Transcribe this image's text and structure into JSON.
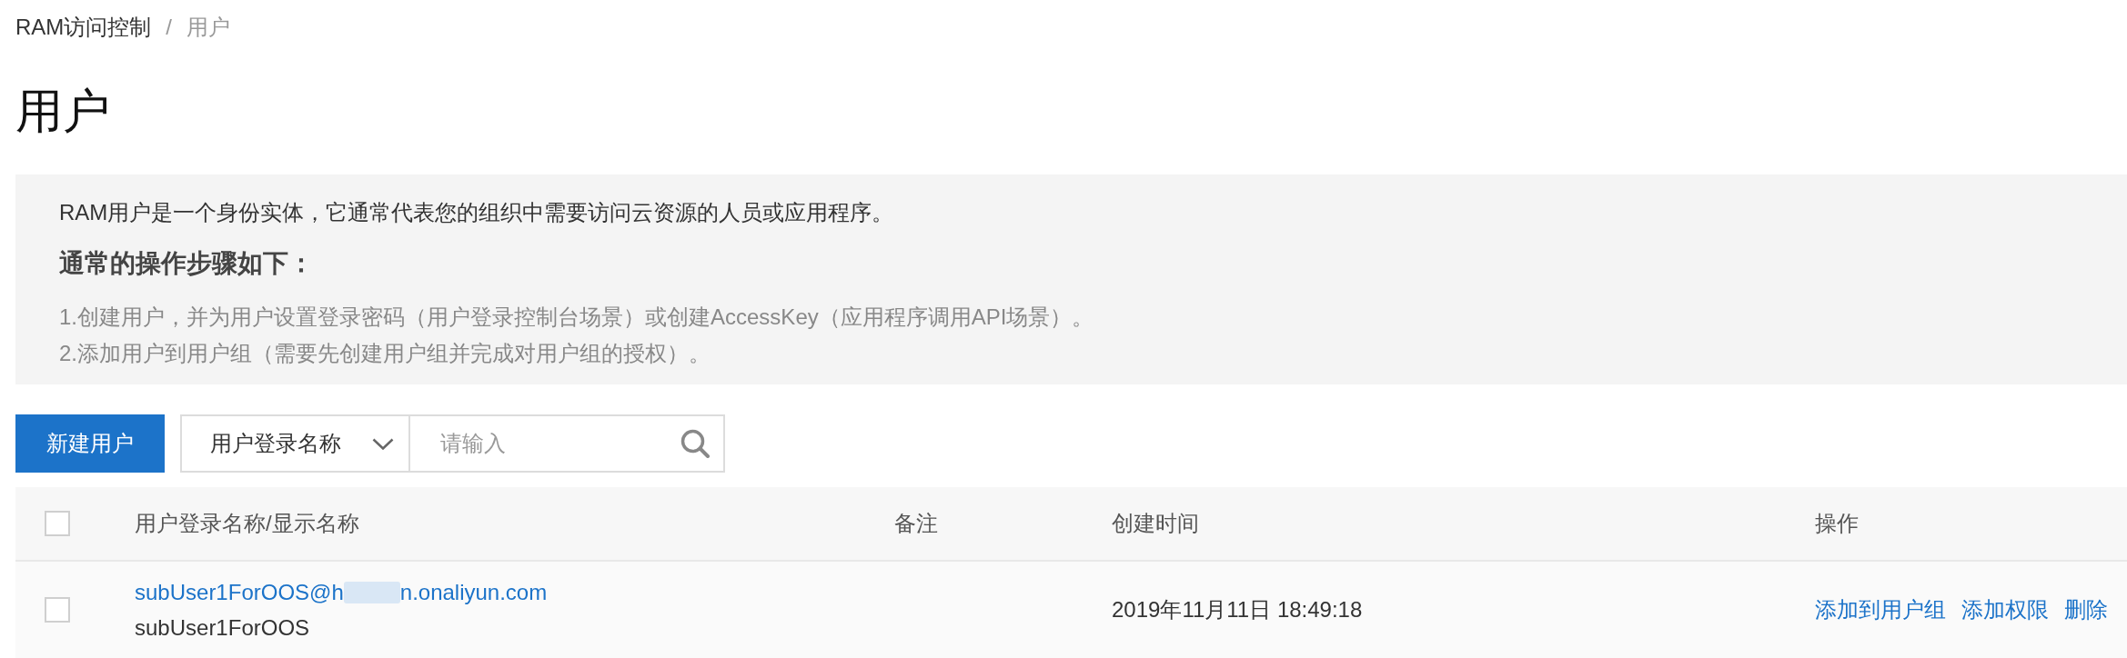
{
  "breadcrumb": [
    {
      "label": "RAM访问控制",
      "current": false
    },
    {
      "label": "用户",
      "current": true
    }
  ],
  "breadcrumb_separator": "/",
  "title": "用户",
  "intro": {
    "description": "RAM用户是一个身份实体，它通常代表您的组织中需要访问云资源的人员或应用程序。",
    "steps_heading": "通常的操作步骤如下：",
    "steps": [
      "1.创建用户，并为用户设置登录密码（用户登录控制台场景）或创建AccessKey（应用程序调用API场景）。",
      "2.添加用户到用户组（需要先创建用户组并完成对用户组的授权）。"
    ]
  },
  "toolbar": {
    "create_button": "新建用户",
    "search_type": "用户登录名称",
    "search": {
      "placeholder": "请输入"
    }
  },
  "table": {
    "select_all_checked": false,
    "columns": [
      "用户登录名称/显示名称",
      "备注",
      "创建时间",
      "操作"
    ],
    "rows": [
      {
        "checked": false,
        "login_name_start": "subUser1ForOOS@h",
        "login_name_redacted": true,
        "login_name_end": "n.onaliyun.com",
        "display_name": "subUser1ForOOS",
        "created": "2019年11月11日 18:49:18",
        "actions": [
          "添加到用户组",
          "添加权限",
          "删除"
        ]
      }
    ]
  }
}
